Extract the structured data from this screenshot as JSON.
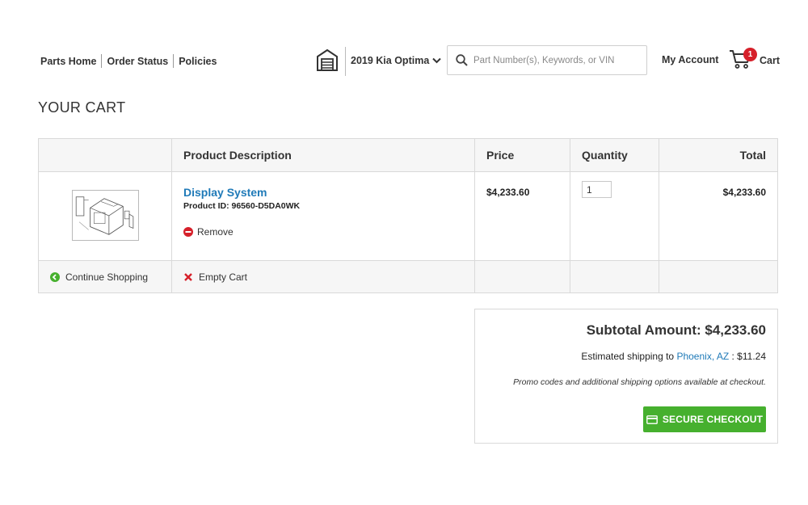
{
  "header": {
    "nav": [
      {
        "label": "Parts Home"
      },
      {
        "label": "Order Status"
      },
      {
        "label": "Policies"
      }
    ],
    "garage_icon": "garage-icon",
    "vehicle": "2019 Kia Optima",
    "search": {
      "placeholder": "Part Number(s), Keywords, or VIN",
      "value": ""
    },
    "account_label": "My Account",
    "cart": {
      "label": "Cart",
      "count": "1"
    }
  },
  "page_title": "YOUR CART",
  "table": {
    "headers": {
      "image": "",
      "description": "Product Description",
      "price": "Price",
      "quantity": "Quantity",
      "total": "Total"
    },
    "items": [
      {
        "name": "Display System",
        "product_id": "Product ID: 96560-D5DA0WK",
        "price": "$4,233.60",
        "quantity": "1",
        "total": "$4,233.60",
        "remove_label": "Remove"
      }
    ],
    "continue_label": "Continue Shopping",
    "empty_label": "Empty Cart"
  },
  "summary": {
    "subtotal": "Subtotal Amount: $4,233.60",
    "shipping_prefix": "Estimated shipping to",
    "shipping_location": "Phoenix, AZ",
    "shipping_suffix": ": $11.24",
    "promo_note": "Promo codes and additional shipping options available at checkout.",
    "checkout_label": "SECURE CHECKOUT"
  },
  "colors": {
    "link": "#1f7ab8",
    "checkout": "#46b02e",
    "badge": "#d6202a",
    "remove": "#d6202a",
    "continue": "#46b02e"
  }
}
